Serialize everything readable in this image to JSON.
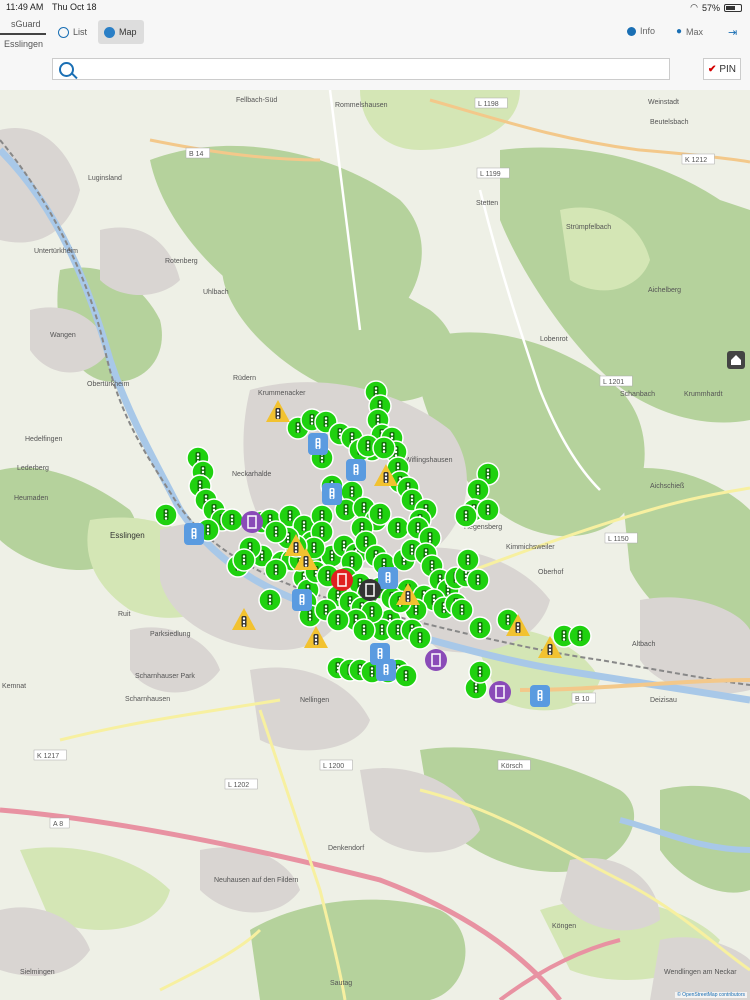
{
  "status": {
    "time": "11:49 AM",
    "date": "Thu Oct 18",
    "battery": "57%"
  },
  "app": {
    "brand_top": "sGuard",
    "brand_bottom": "Esslingen"
  },
  "tabs": [
    {
      "label": "List"
    },
    {
      "label": "Map"
    }
  ],
  "header": {
    "info_label": "Info",
    "user_label": "Max"
  },
  "search": {
    "placeholder": "",
    "value": ""
  },
  "pin_button": {
    "label": "PIN"
  },
  "map": {
    "attribution": "© OpenStreetMap contributors",
    "place_labels": [
      "Weinstadt",
      "Beutelsbach",
      "Rommelshausen",
      "Fellbach-Süd",
      "Luginsland",
      "Stetten",
      "Strümpfelbach",
      "Untertürkheim",
      "Rotenberg",
      "Uhlbach",
      "Aichelberg",
      "Wangen",
      "Lobenrot",
      "Obertürkheim",
      "Rüdern",
      "Krummenacker",
      "Schanbach",
      "Krummhardt",
      "Hedelfingen",
      "Lederberg",
      "Neckarhalde",
      "Wiflingshausen",
      "Heumaden",
      "Hegensberg",
      "Aichschieß",
      "Kimmichsweiler",
      "Oberhof",
      "Ruit",
      "Parksiedlung",
      "Scharnhauser Park",
      "Altbach",
      "Kemnat",
      "Scharnhausen",
      "Nellingen",
      "Deizisau",
      "Denkendorf",
      "Neuhausen auf den Fildern",
      "Köngen",
      "Sielmingen",
      "Wendlingen am Neckar",
      "Esslingen",
      "Sautag"
    ],
    "road_labels": [
      "B 14",
      "L 1198",
      "L 1199",
      "K 1212",
      "L 1201",
      "L 1150",
      "B 10",
      "K 1217",
      "L 1202",
      "L 1200",
      "A 8",
      "Körsch"
    ],
    "marker_counts": {
      "traffic_light_green": 130,
      "traffic_light_blue": 9,
      "warning": 9,
      "hydrant_purple": 3,
      "hydrant_red": 1,
      "black": 1
    }
  }
}
